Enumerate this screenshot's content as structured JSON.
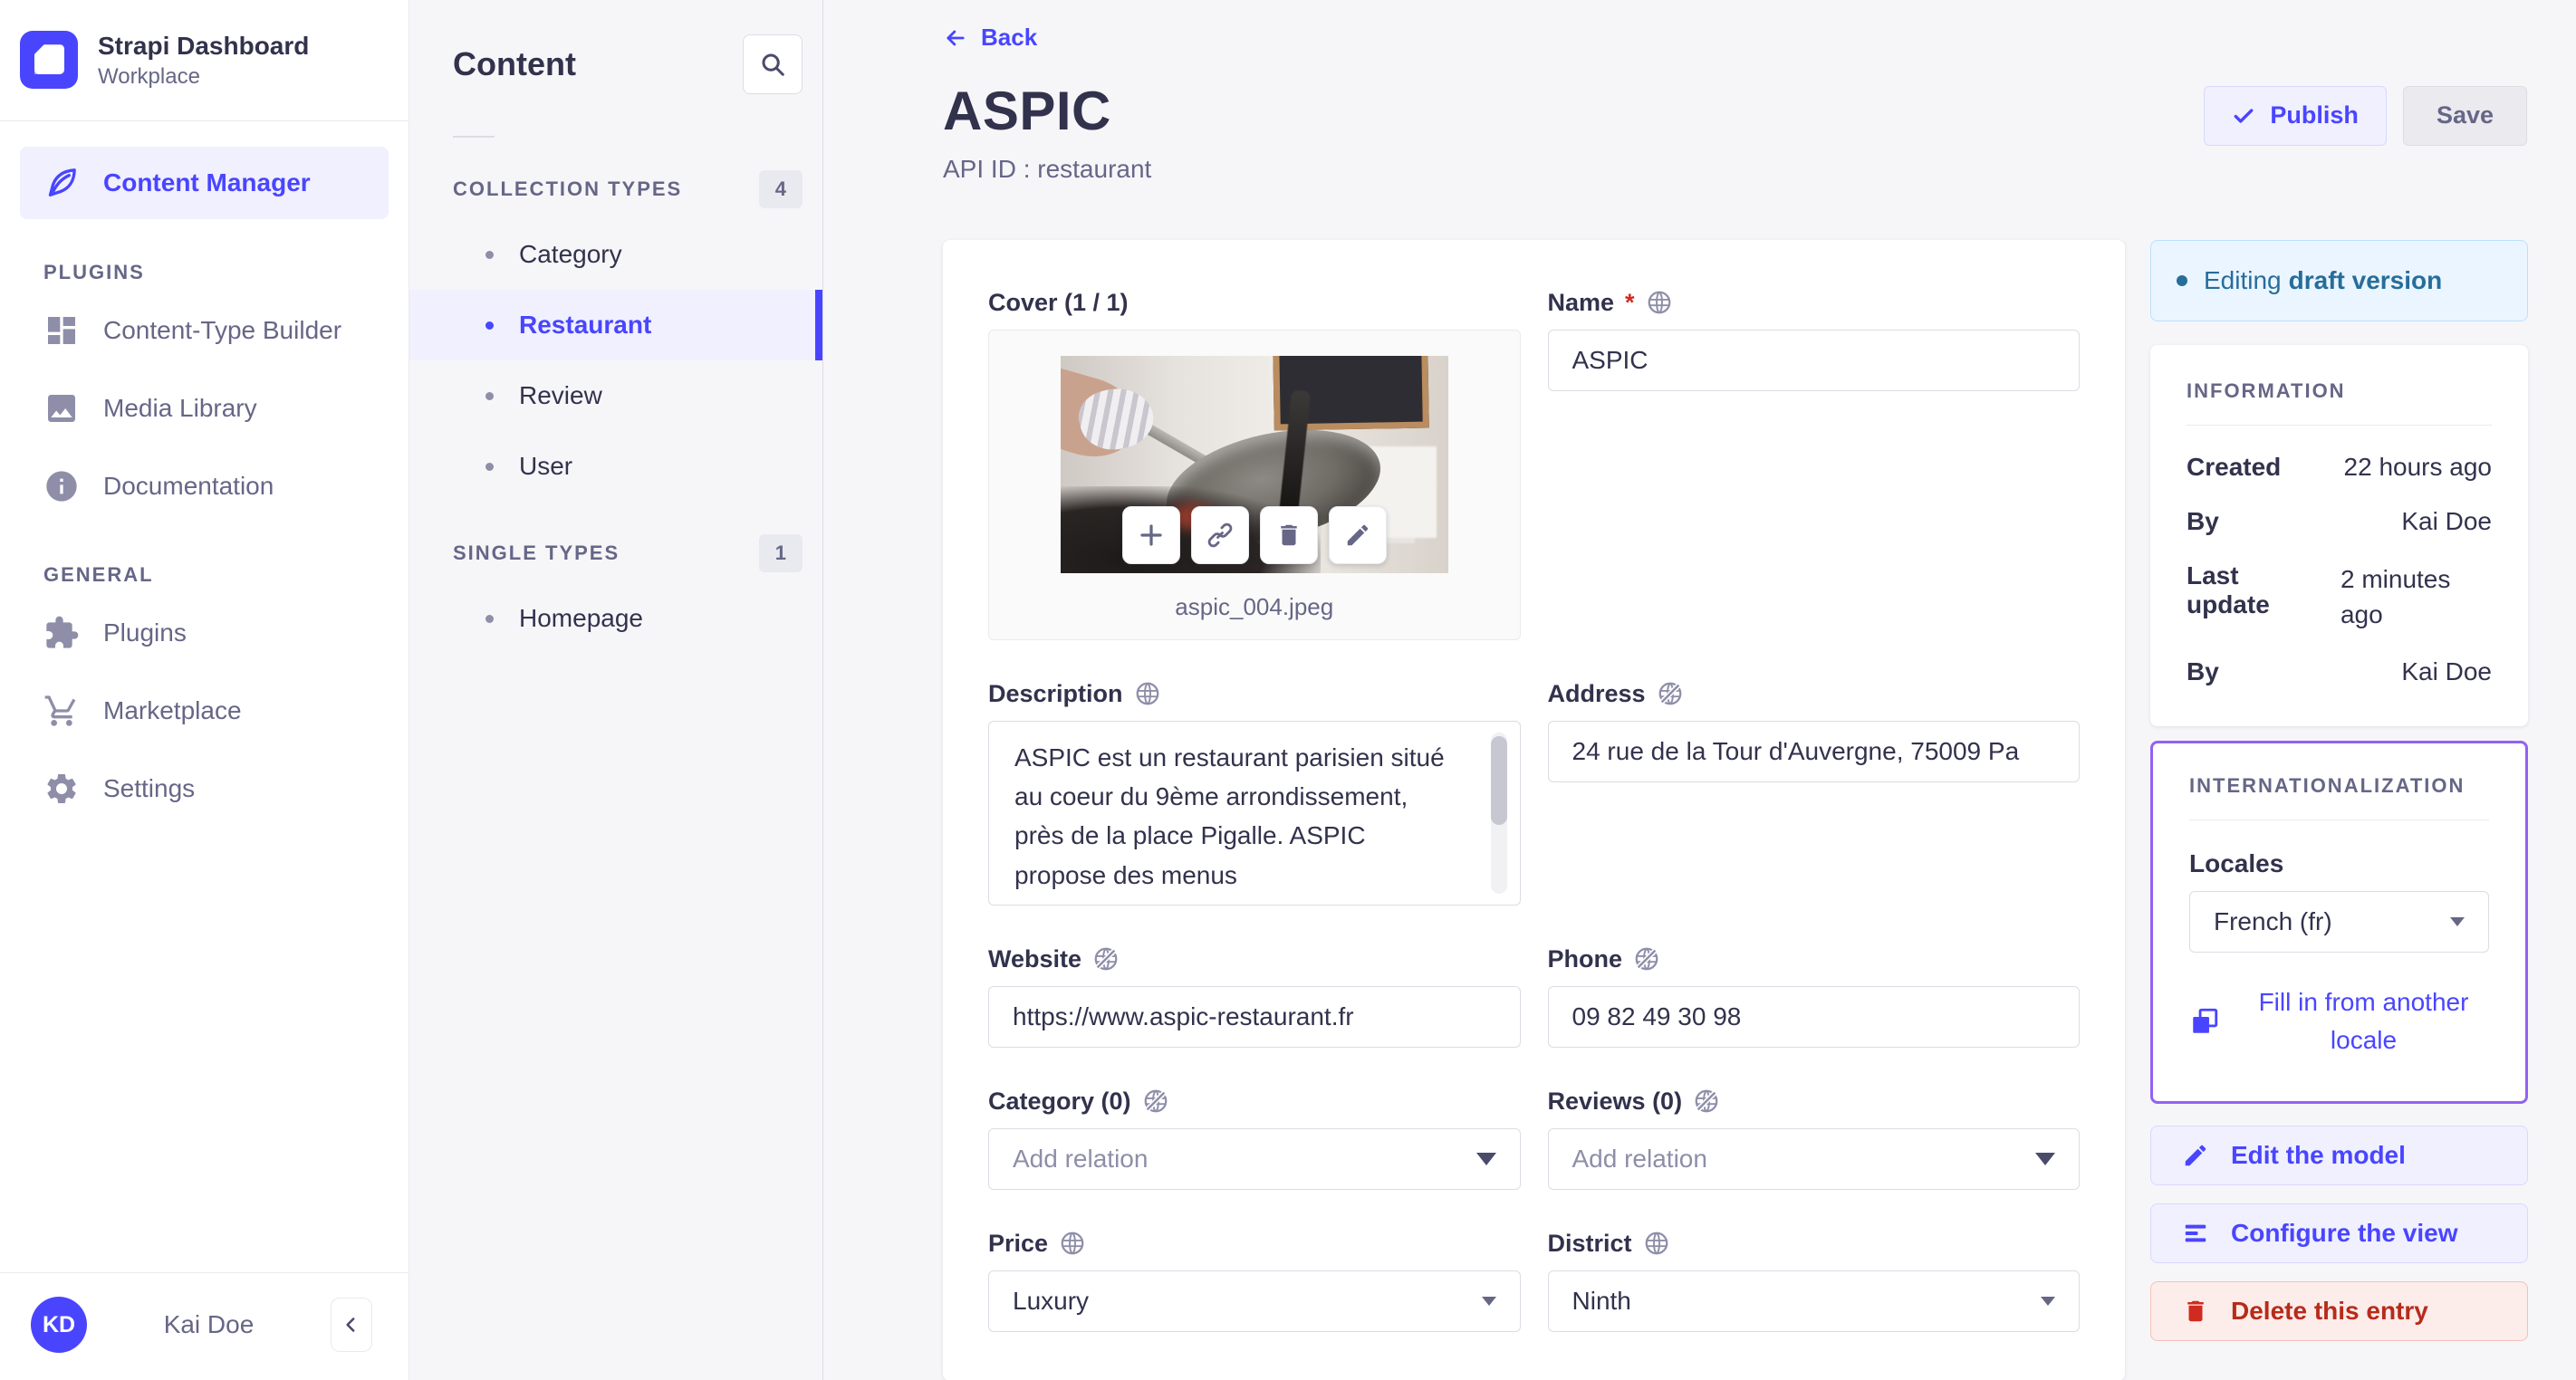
{
  "brand": {
    "title": "Strapi Dashboard",
    "subtitle": "Workplace"
  },
  "nav": {
    "content_manager": "Content Manager",
    "plugins_heading": "PLUGINS",
    "plugins_items": [
      "Content-Type Builder",
      "Media Library",
      "Documentation"
    ],
    "general_heading": "GENERAL",
    "general_items": [
      "Plugins",
      "Marketplace",
      "Settings"
    ],
    "user_initials": "KD",
    "user_name": "Kai Doe"
  },
  "content_panel": {
    "title": "Content",
    "collection_heading": "COLLECTION TYPES",
    "collection_count": "4",
    "collection_items": [
      "Category",
      "Restaurant",
      "Review",
      "User"
    ],
    "single_heading": "SINGLE TYPES",
    "single_count": "1",
    "single_items": [
      "Homepage"
    ]
  },
  "header": {
    "back": "Back",
    "title": "ASPIC",
    "subtitle": "API ID : restaurant",
    "publish": "Publish",
    "save": "Save"
  },
  "form": {
    "cover_label": "Cover (1 / 1)",
    "cover_filename": "aspic_004.jpeg",
    "name_label": "Name",
    "name_required": "*",
    "name_value": "ASPIC",
    "description_label": "Description",
    "description_value": "ASPIC est un restaurant parisien situé au coeur du 9ème arrondissement, près de la place Pigalle. ASPIC propose des menus",
    "address_label": "Address",
    "address_value": "24 rue de la Tour d'Auvergne, 75009 Pa",
    "website_label": "Website",
    "website_value": "https://www.aspic-restaurant.fr",
    "phone_label": "Phone",
    "phone_value": "09 82 49 30 98",
    "category_label": "Category (0)",
    "category_placeholder": "Add relation",
    "reviews_label": "Reviews (0)",
    "reviews_placeholder": "Add relation",
    "price_label": "Price",
    "price_value": "Luxury",
    "district_label": "District",
    "district_value": "Ninth"
  },
  "aside": {
    "draft_prefix": "Editing",
    "draft_emphasis": "draft version",
    "info_heading": "INFORMATION",
    "info_rows": [
      {
        "label": "Created",
        "value": "22 hours ago"
      },
      {
        "label": "By",
        "value": "Kai Doe"
      },
      {
        "label": "Last update",
        "value": "2 minutes ago"
      },
      {
        "label": "By",
        "value": "Kai Doe"
      }
    ],
    "i18n_heading": "INTERNATIONALIZATION",
    "locales_label": "Locales",
    "locale_value": "French (fr)",
    "fill_link": "Fill in from another locale",
    "edit_model": "Edit the model",
    "configure_view": "Configure the view",
    "delete_entry": "Delete this entry"
  },
  "colors": {
    "accent": "#4945ff",
    "accent_bg": "#f0f0ff",
    "draft_text": "#266d9b",
    "draft_bg": "#eaf5ff",
    "draft_border": "#b8e1ff",
    "i18n_border": "#9362f2",
    "danger_text": "#b72b1a",
    "danger_bg": "#fcecea",
    "required": "#d02b20"
  },
  "icons": {
    "search": "magnifier",
    "back": "arrow-left",
    "publish": "check",
    "cover_actions": [
      "plus",
      "link",
      "trash",
      "pencil"
    ],
    "localized": "globe",
    "not_localized": "globe-slash",
    "locale_fill": "copy",
    "edit_model": "pencil",
    "configure_view": "list-lines",
    "delete_entry": "trash"
  }
}
